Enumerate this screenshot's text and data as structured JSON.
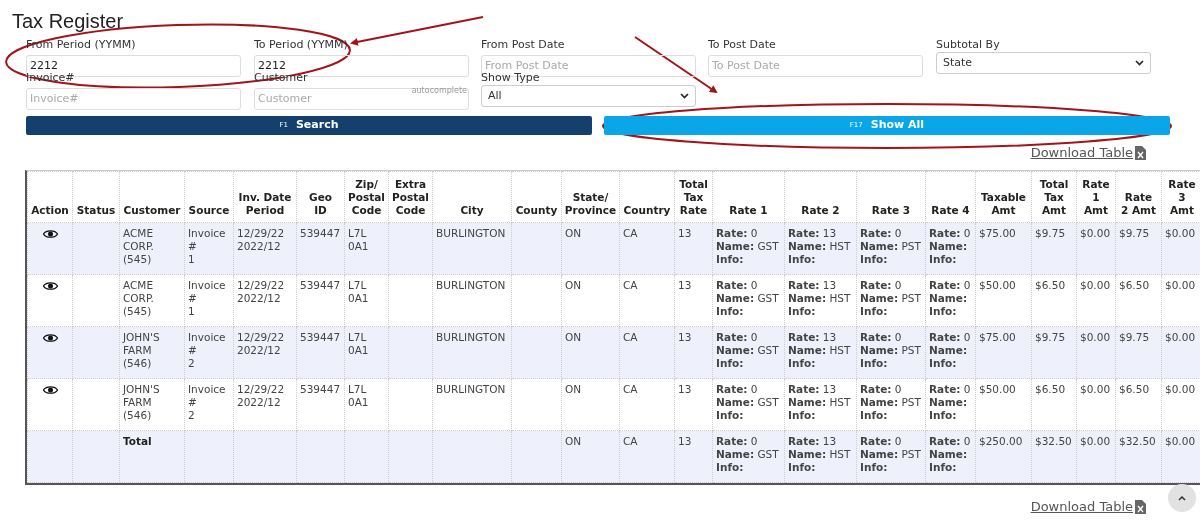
{
  "title": "Tax Register",
  "filters": [
    {
      "kind": "input",
      "label": "From Period (YYMM)",
      "value": "2212"
    },
    {
      "kind": "input",
      "label": "To Period (YYMM)",
      "value": "2212"
    },
    {
      "kind": "input",
      "label": "From Post Date",
      "placeholder": "From Post Date"
    },
    {
      "kind": "input",
      "label": "To Post Date",
      "placeholder": "To Post Date"
    },
    {
      "kind": "select",
      "label": "Subtotal By",
      "value": "State"
    },
    {
      "kind": "input",
      "label": "Invoice#",
      "placeholder": "Invoice#"
    },
    {
      "kind": "input",
      "label": "Customer",
      "placeholder": "Customer",
      "hint": "autocomplete"
    },
    {
      "kind": "select",
      "label": "Show Type",
      "value": "All"
    }
  ],
  "buttons": [
    {
      "kind": "primary",
      "key": "F1",
      "label": "Search"
    },
    {
      "kind": "secondary",
      "key": "F17",
      "label": "Show All"
    }
  ],
  "download_links": [
    "Download Table",
    "Download Table"
  ],
  "table": {
    "columns": [
      "Action",
      "Status",
      "Customer",
      "Source",
      "Inv. Date\nPeriod",
      "Geo\nID",
      "Zip/\nPostal\nCode",
      "Extra\nPostal\nCode",
      "City",
      "County",
      "State/\nProvince",
      "Country",
      "Total\nTax\nRate",
      "Rate 1",
      "Rate 2",
      "Rate 3",
      "Rate 4",
      "Taxable\nAmt",
      "Total\nTax\nAmt",
      "Rate\n1\nAmt",
      "Rate\n2 Amt",
      "Rate\n3\nAmt"
    ],
    "rows": [
      {
        "kind": "item",
        "cells": [
          null,
          null,
          "ACME\nCORP.\n(545)",
          "Invoice\n#\n1",
          "12/29/22\n2022/12",
          "539447",
          "L7L\n0A1",
          null,
          "BURLINGTON",
          null,
          "ON",
          "CA",
          "13",
          "**Rate:** 0\n**Name:** GST\n**Info:**",
          "**Rate:** 13\n**Name:** HST\n**Info:**",
          "**Rate:** 0\n**Name:** PST\n**Info:**",
          "**Rate:** 0\n**Name:**\n**Info:**",
          "$75.00",
          "$9.75",
          "$0.00",
          "$9.75",
          "$0.00"
        ]
      },
      {
        "kind": "item",
        "cells": [
          null,
          null,
          "ACME\nCORP.\n(545)",
          "Invoice\n#\n1",
          "12/29/22\n2022/12",
          "539447",
          "L7L\n0A1",
          null,
          "BURLINGTON",
          null,
          "ON",
          "CA",
          "13",
          "**Rate:** 0\n**Name:** GST\n**Info:**",
          "**Rate:** 13\n**Name:** HST\n**Info:**",
          "**Rate:** 0\n**Name:** PST\n**Info:**",
          "**Rate:** 0\n**Name:**\n**Info:**",
          "$50.00",
          "$6.50",
          "$0.00",
          "$6.50",
          "$0.00"
        ]
      },
      {
        "kind": "item",
        "cells": [
          null,
          null,
          "JOHN'S\nFARM\n(546)",
          "Invoice\n#\n2",
          "12/29/22\n2022/12",
          "539447",
          "L7L\n0A1",
          null,
          "BURLINGTON",
          null,
          "ON",
          "CA",
          "13",
          "**Rate:** 0\n**Name:** GST\n**Info:**",
          "**Rate:** 13\n**Name:** HST\n**Info:**",
          "**Rate:** 0\n**Name:** PST\n**Info:**",
          "**Rate:** 0\n**Name:**\n**Info:**",
          "$75.00",
          "$9.75",
          "$0.00",
          "$9.75",
          "$0.00"
        ]
      },
      {
        "kind": "item",
        "cells": [
          null,
          null,
          "JOHN'S\nFARM\n(546)",
          "Invoice\n#\n2",
          "12/29/22\n2022/12",
          "539447",
          "L7L\n0A1",
          null,
          "BURLINGTON",
          null,
          "ON",
          "CA",
          "13",
          "**Rate:** 0\n**Name:** GST\n**Info:**",
          "**Rate:** 13\n**Name:** HST\n**Info:**",
          "**Rate:** 0\n**Name:** PST\n**Info:**",
          "**Rate:** 0\n**Name:**\n**Info:**",
          "$50.00",
          "$6.50",
          "$0.00",
          "$6.50",
          "$0.00"
        ]
      },
      {
        "kind": "total",
        "cells": [
          null,
          null,
          "Total",
          null,
          null,
          null,
          null,
          null,
          null,
          null,
          "ON",
          "CA",
          "13",
          "**Rate:** 0\n**Name:** GST\n**Info:**",
          "**Rate:** 13\n**Name:** HST\n**Info:**",
          "**Rate:** 0\n**Name:** PST\n**Info:**",
          "**Rate:** 0\n**Name:**\n**Info:**",
          "$250.00",
          "$32.50",
          "$0.00",
          "$32.50",
          "$0.00"
        ]
      }
    ]
  }
}
